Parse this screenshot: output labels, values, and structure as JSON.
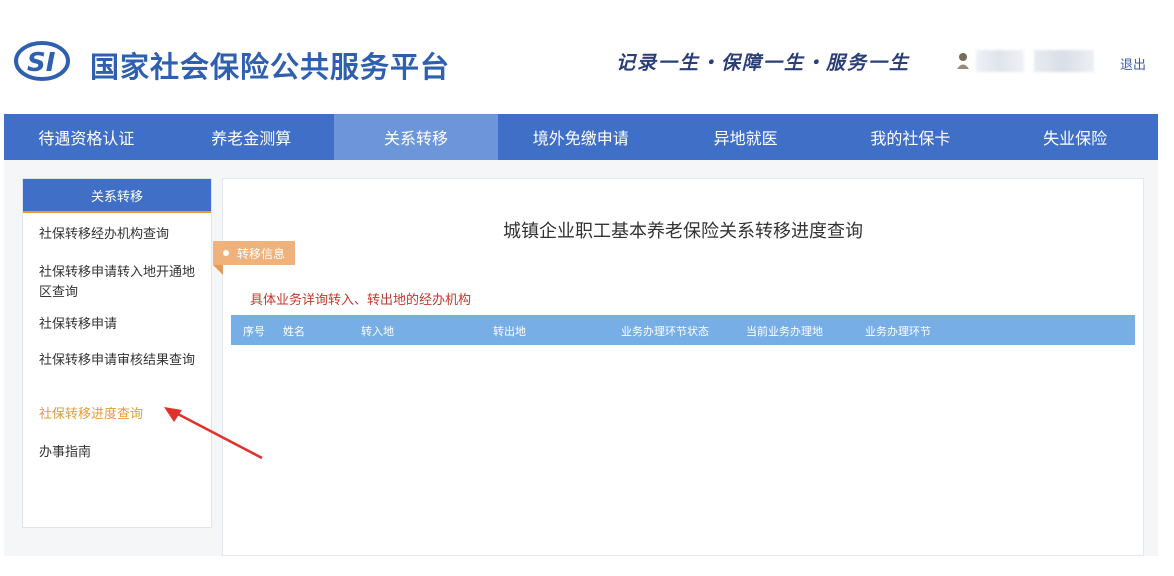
{
  "header": {
    "site_title": "国家社会保险公共服务平台",
    "slogan": "记录一生・保障一生・服务一生",
    "logout_label": "退出",
    "brand_color": "#2f60b0"
  },
  "nav": {
    "items": [
      {
        "label": "待遇资格认证"
      },
      {
        "label": "养老金测算"
      },
      {
        "label": "关系转移"
      },
      {
        "label": "境外免缴申请"
      },
      {
        "label": "异地就医"
      },
      {
        "label": "我的社保卡"
      },
      {
        "label": "失业保险"
      }
    ],
    "active_index": 2,
    "bar_color": "#3f6fc6"
  },
  "sidebar": {
    "heading": "关系转移",
    "items": [
      {
        "label": "社保转移经办机构查询"
      },
      {
        "label": "社保转移申请转入地开通地区查询"
      },
      {
        "label": "社保转移申请"
      },
      {
        "label": "社保转移申请审核结果查询"
      },
      {
        "label": "社保转移进度查询"
      },
      {
        "label": "办事指南"
      }
    ],
    "active_index": 4,
    "active_color": "#e39b3c"
  },
  "main": {
    "title": "城镇企业职工基本养老保险关系转移进度查询",
    "tag_label": "转移信息",
    "hint": "具体业务详询转入、转出地的经办机构",
    "columns": [
      "序号",
      "姓名",
      "转入地",
      "转出地",
      "业务办理环节状态",
      "当前业务办理地",
      "业务办理环节"
    ]
  }
}
